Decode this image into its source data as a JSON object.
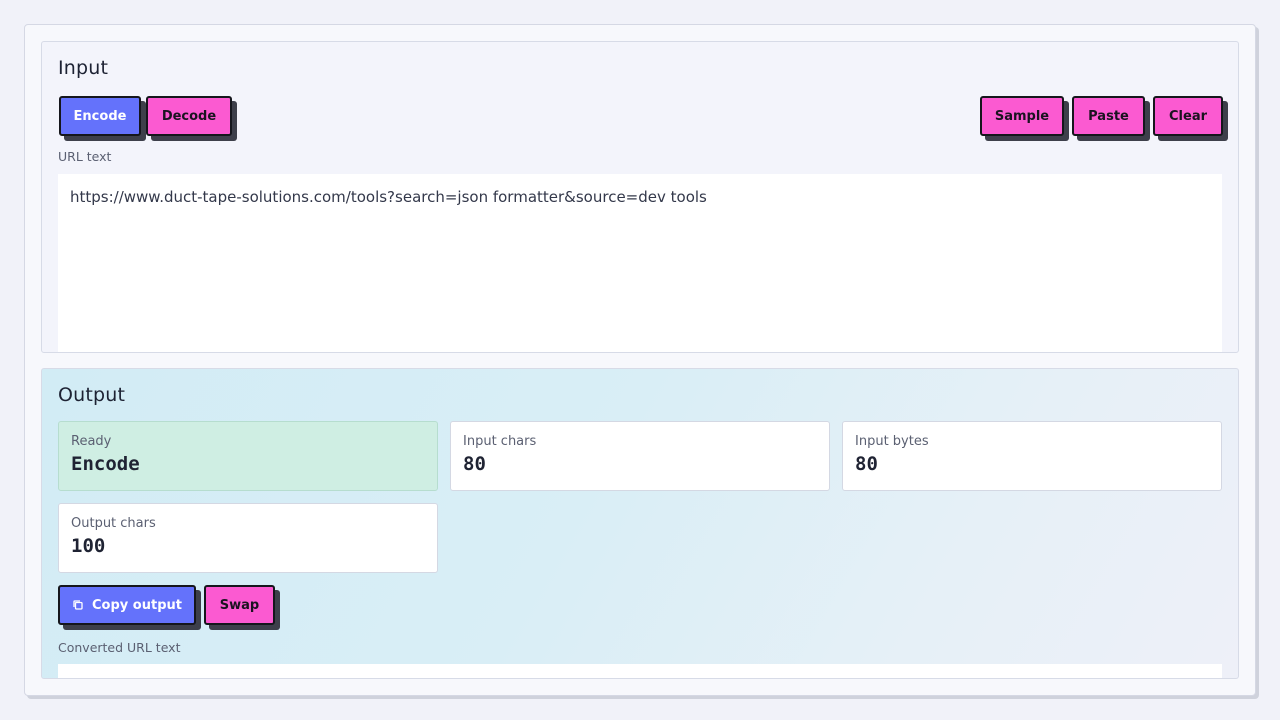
{
  "input": {
    "title": "Input",
    "buttons": {
      "encode": "Encode",
      "decode": "Decode",
      "sample": "Sample",
      "paste": "Paste",
      "clear": "Clear"
    },
    "field_label": "URL text",
    "field_value": "https://www.duct-tape-solutions.com/tools?search=json formatter&source=dev tools"
  },
  "output": {
    "title": "Output",
    "stats": {
      "ready": {
        "label": "Ready",
        "value": "Encode"
      },
      "input_chars": {
        "label": "Input chars",
        "value": "80"
      },
      "input_bytes": {
        "label": "Input bytes",
        "value": "80"
      },
      "output_chars": {
        "label": "Output chars",
        "value": "100"
      }
    },
    "buttons": {
      "copy": "Copy output",
      "swap": "Swap"
    },
    "field_label": "Converted URL text",
    "field_value": ""
  },
  "icons": {
    "copy": "copy-icon"
  },
  "colors": {
    "primary_blue": "#6472fb",
    "accent_pink": "#fb5ad1",
    "ready_green": "#cfeee3",
    "button_border": "#15161c"
  }
}
